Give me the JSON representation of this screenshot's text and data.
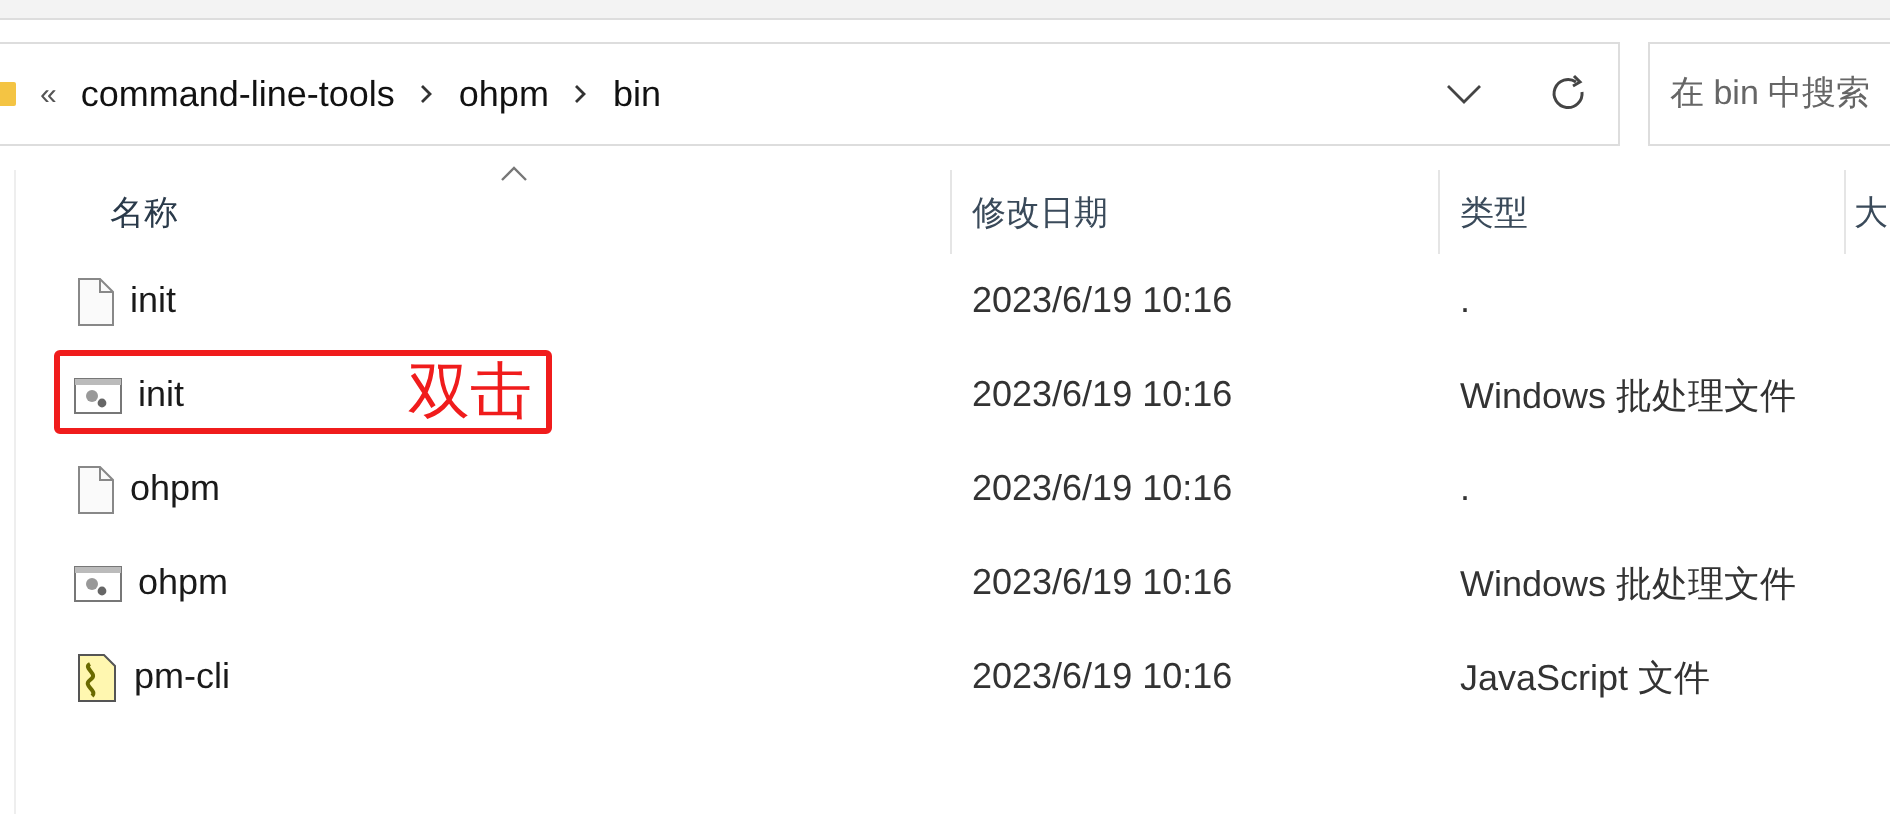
{
  "address_bar": {
    "overflow": "«",
    "path": [
      "command-line-tools",
      "ohpm",
      "bin"
    ]
  },
  "search": {
    "placeholder": "在 bin 中搜索"
  },
  "table": {
    "columns": [
      {
        "label": "名称",
        "sorted": true
      },
      {
        "label": "修改日期",
        "sorted": false
      },
      {
        "label": "类型",
        "sorted": false
      },
      {
        "label": "大",
        "sorted": false
      }
    ],
    "rows": [
      {
        "kind": "file",
        "name": "init",
        "modified": "2023/6/19 10:16",
        "type": "."
      },
      {
        "kind": "batch",
        "name": "init",
        "modified": "2023/6/19 10:16",
        "type": "Windows 批处理文件",
        "callout": "双击"
      },
      {
        "kind": "file",
        "name": "ohpm",
        "modified": "2023/6/19 10:16",
        "type": "."
      },
      {
        "kind": "batch",
        "name": "ohpm",
        "modified": "2023/6/19 10:16",
        "type": "Windows 批处理文件"
      },
      {
        "kind": "script",
        "name": "pm-cli",
        "modified": "2023/6/19 10:16",
        "type": "JavaScript 文件"
      }
    ]
  }
}
